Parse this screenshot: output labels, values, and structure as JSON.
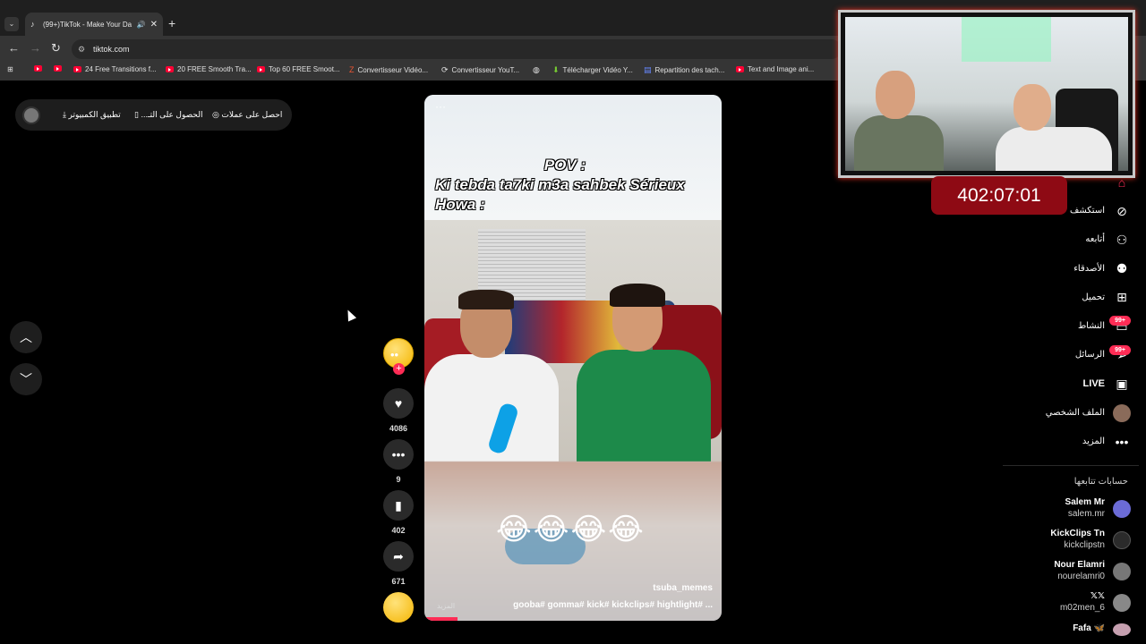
{
  "browser": {
    "tab_title": "(99+)TikTok - Make Your Da",
    "url": "tiktok.com",
    "bookmarks": [
      {
        "label": "",
        "icon": "youtube-icon"
      },
      {
        "label": "",
        "icon": "youtube-icon"
      },
      {
        "label": "24 Free Transitions f...",
        "icon": "youtube-icon"
      },
      {
        "label": "20 FREE Smooth Tra...",
        "icon": "youtube-icon"
      },
      {
        "label": "Top 60 FREE Smoot...",
        "icon": "youtube-icon"
      },
      {
        "label": "Convertisseur Vidéo...",
        "icon": "z-icon"
      },
      {
        "label": "Convertisseur YouT...",
        "icon": "converter-icon"
      },
      {
        "label": "",
        "icon": "globe-icon"
      },
      {
        "label": "Télécharger Vidéo Y...",
        "icon": "download-icon"
      },
      {
        "label": "Repartition des tach...",
        "icon": "doc-icon"
      },
      {
        "label": "Text and Image ani...",
        "icon": "youtube-icon"
      }
    ]
  },
  "topbar": {
    "coins": "احصل على عملات",
    "get_app": "الحصول على التـ...",
    "desktop_app": "تطبيق الكمبيوتر"
  },
  "video": {
    "caption_line1": "POV :",
    "caption_line2": "Ki tebda ta7ki m3a sahbek Sérieux",
    "caption_line3": "Howa :",
    "emojis": "😂😂😂😂",
    "username": "tsuba_memes",
    "hashtags": "gooba# gomma# kick# kickclips# hightlight# ...",
    "more": "المزيد"
  },
  "actions": {
    "likes": "4086",
    "comments": "9",
    "saves": "402",
    "shares": "671"
  },
  "overlay": {
    "timer": "402:07:01"
  },
  "nav": {
    "explore": "استكشف",
    "following": "أتابعه",
    "friends": "الأصدقاء",
    "upload": "تحميل",
    "activity": "النشاط",
    "activity_badge": "99+",
    "messages": "الرسائل",
    "messages_badge": "99+",
    "live": "LIVE",
    "profile": "الملف الشخصي",
    "more": "المزيد"
  },
  "following_accounts": {
    "title": "حسابات تتابعها",
    "accounts": [
      {
        "name": "Salem Mr",
        "handle": "salem.mr"
      },
      {
        "name": "KickClips Tn",
        "handle": "kickclipstn"
      },
      {
        "name": "Nour Elamri",
        "handle": "nourelamri0"
      },
      {
        "name": "𝕏𝕏",
        "handle": "m02men_6"
      },
      {
        "name": "Fafa 🦋",
        "handle": ""
      }
    ]
  },
  "colors": {
    "accent": "#fe2c55",
    "timer_bg": "#8e0a14",
    "background": "#000000"
  }
}
